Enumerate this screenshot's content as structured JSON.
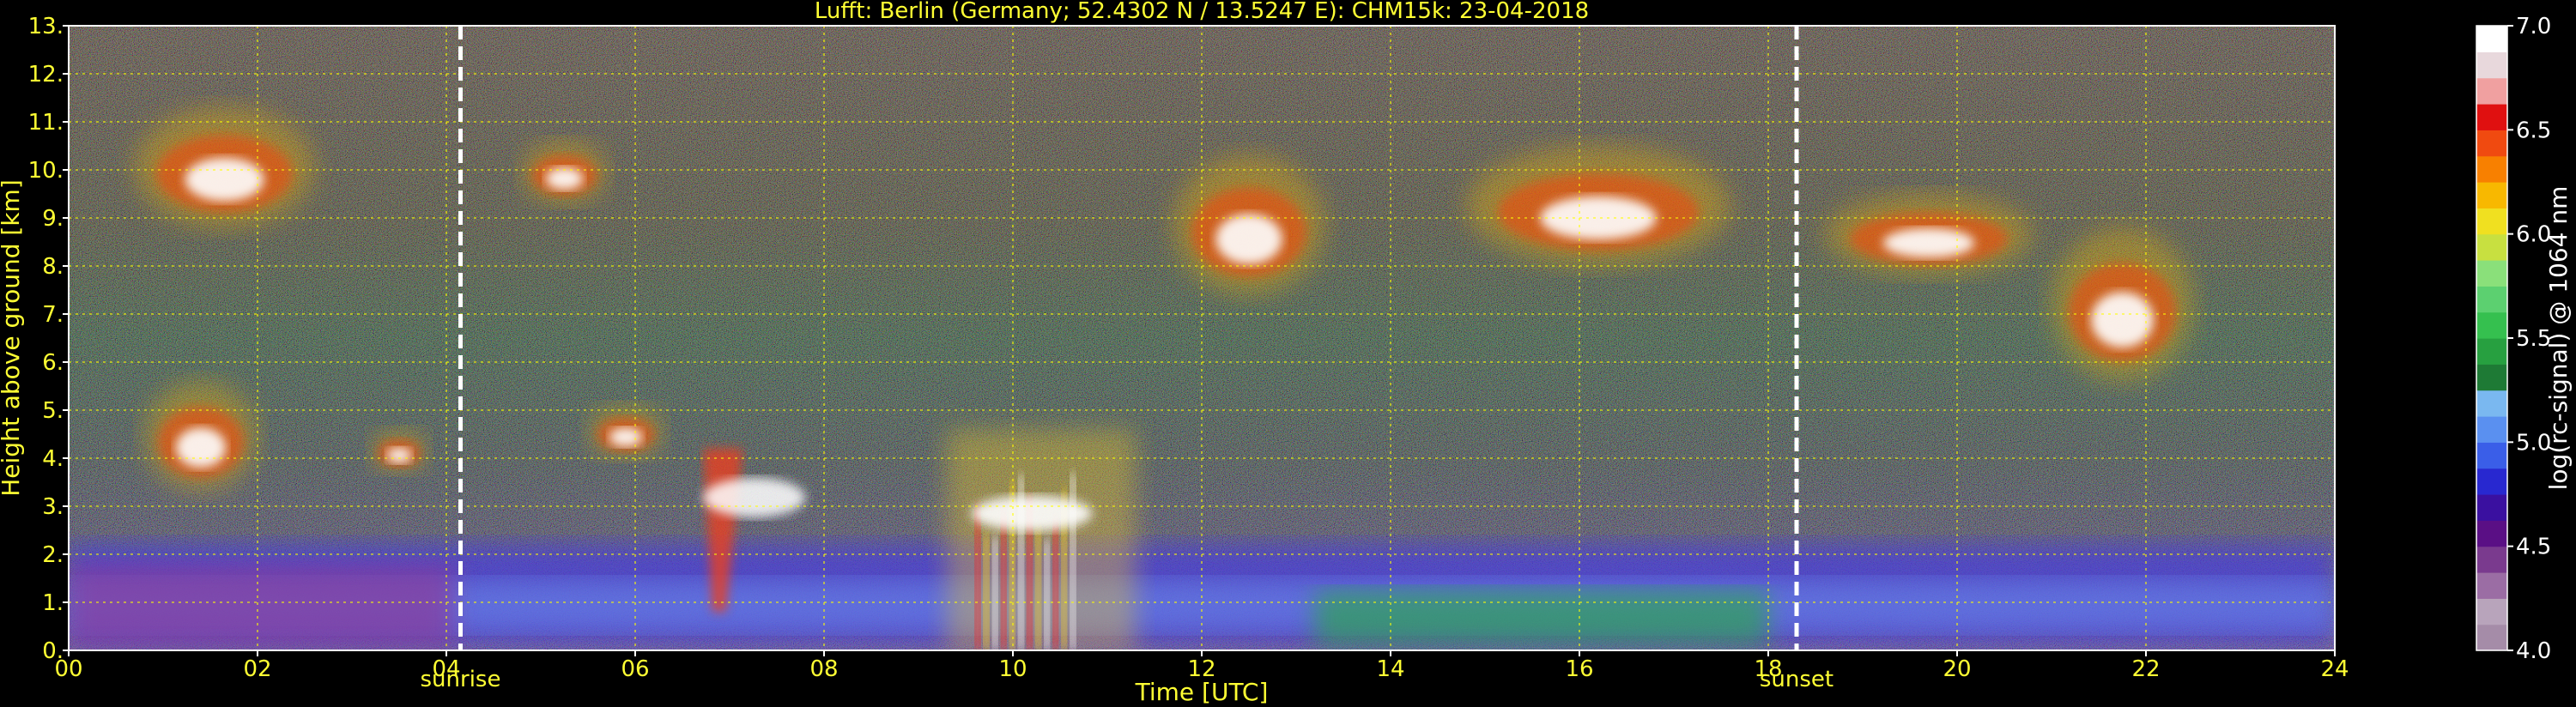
{
  "chart_data": {
    "type": "heatmap",
    "title": "Lufft: Berlin (Germany; 52.4302 N / 13.5247 E):    CHM15k: 23-04-2018",
    "xlabel": "Time [UTC]",
    "ylabel": "Height above ground [km]",
    "xlim": [
      0,
      24
    ],
    "ylim": [
      0,
      13
    ],
    "x_ticks": [
      "00",
      "02",
      "04",
      "06",
      "08",
      "10",
      "12",
      "14",
      "16",
      "18",
      "20",
      "22",
      "24"
    ],
    "y_ticks": [
      "0.",
      "1.",
      "2.",
      "3.",
      "4.",
      "5.",
      "6.",
      "7.",
      "8.",
      "9.",
      "10.",
      "11.",
      "12.",
      "13."
    ],
    "grid": true,
    "colorbar": {
      "label": "log(rc-signal) @ 1064 nm",
      "range": [
        4.0,
        7.0
      ],
      "ticks": [
        "4.0",
        "4.5",
        "5.0",
        "5.5",
        "6.0",
        "6.5",
        "7.0"
      ],
      "colors": [
        "#a58ca8",
        "#b8a4bb",
        "#9b6da4",
        "#7a3a8e",
        "#5a0f85",
        "#3a10a0",
        "#2828d0",
        "#3a5ee8",
        "#5a90f0",
        "#7ab8f0",
        "#1e7a35",
        "#27a040",
        "#35c04f",
        "#5cd070",
        "#8ae07a",
        "#c8e040",
        "#f0e020",
        "#f8b800",
        "#f88000",
        "#f04a10",
        "#e01010",
        "#f0a0a0",
        "#e8d8dc",
        "#ffffff"
      ]
    },
    "markers": [
      {
        "label": "sunrise",
        "time": 4.15
      },
      {
        "label": "sunset",
        "time": 18.3
      }
    ],
    "features": [
      {
        "name": "boundary-layer-aerosol",
        "time_range": [
          0,
          24
        ],
        "height_range_km": [
          0.1,
          2.2
        ]
      },
      {
        "name": "mid-level-cloud-1",
        "time_range": [
          0.8,
          2.0
        ],
        "height_range_km": [
          3.3,
          5.6
        ]
      },
      {
        "name": "mid-level-cloud-2",
        "time_range": [
          3.2,
          3.8
        ],
        "height_range_km": [
          3.7,
          4.6
        ]
      },
      {
        "name": "mid-level-cloud-3",
        "time_range": [
          5.5,
          6.3
        ],
        "height_range_km": [
          4.0,
          5.1
        ]
      },
      {
        "name": "falling-streak",
        "time_range": [
          6.6,
          7.8
        ],
        "height_range_km": [
          0.8,
          4.2
        ]
      },
      {
        "name": "convective-cloud",
        "time_range": [
          9.3,
          11.3
        ],
        "height_range_km": [
          0,
          4.6
        ]
      },
      {
        "name": "cirrus-1",
        "time_range": [
          0.7,
          2.6
        ],
        "height_range_km": [
          8.8,
          11.3
        ]
      },
      {
        "name": "cirrus-2",
        "time_range": [
          4.8,
          5.7
        ],
        "height_range_km": [
          9.3,
          10.6
        ]
      },
      {
        "name": "cirrus-3",
        "time_range": [
          11.7,
          13.3
        ],
        "height_range_km": [
          7.4,
          10.3
        ]
      },
      {
        "name": "cirrus-4",
        "time_range": [
          14.8,
          17.6
        ],
        "height_range_km": [
          8.0,
          10.5
        ]
      },
      {
        "name": "cirrus-5",
        "time_range": [
          18.6,
          20.8
        ],
        "height_range_km": [
          7.8,
          9.5
        ]
      },
      {
        "name": "cirrus-6",
        "time_range": [
          21.0,
          22.5
        ],
        "height_range_km": [
          5.6,
          8.8
        ]
      }
    ]
  }
}
